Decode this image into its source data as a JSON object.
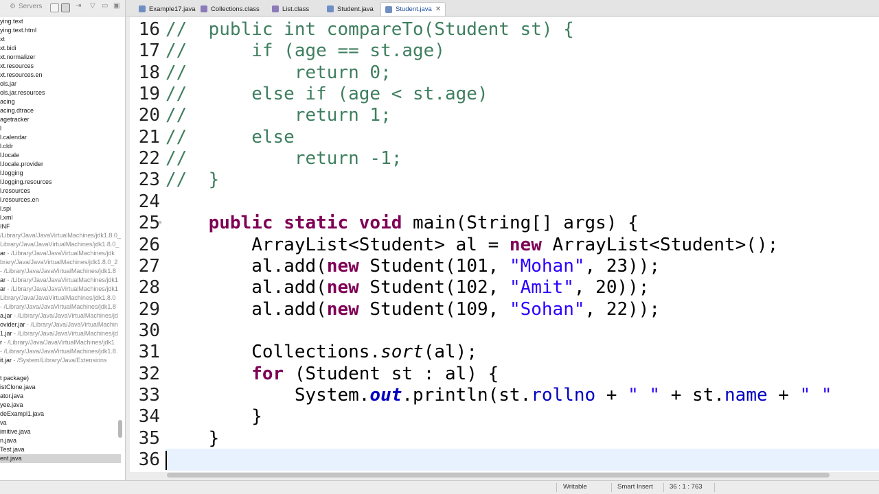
{
  "left_panel": {
    "tab_label": "Servers",
    "tree_items": [
      {
        "name": "ying.text",
        "sub": ""
      },
      {
        "name": "ying.text.html",
        "sub": ""
      },
      {
        "name": "xt",
        "sub": ""
      },
      {
        "name": "xt.bidi",
        "sub": ""
      },
      {
        "name": "xt.normalizer",
        "sub": ""
      },
      {
        "name": "xt.resources",
        "sub": ""
      },
      {
        "name": "xt.resources.en",
        "sub": ""
      },
      {
        "name": "ols.jar",
        "sub": ""
      },
      {
        "name": "ols.jar.resources",
        "sub": ""
      },
      {
        "name": "acing",
        "sub": ""
      },
      {
        "name": "acing.dtrace",
        "sub": ""
      },
      {
        "name": "agetracker",
        "sub": ""
      },
      {
        "name": "l",
        "sub": ""
      },
      {
        "name": "l.calendar",
        "sub": ""
      },
      {
        "name": "l.cldr",
        "sub": ""
      },
      {
        "name": "l.locale",
        "sub": ""
      },
      {
        "name": "l.locale.provider",
        "sub": ""
      },
      {
        "name": "l.logging",
        "sub": ""
      },
      {
        "name": "l.logging.resources",
        "sub": ""
      },
      {
        "name": "l.resources",
        "sub": ""
      },
      {
        "name": "l.resources.en",
        "sub": ""
      },
      {
        "name": "l.spi",
        "sub": ""
      },
      {
        "name": "l.xml",
        "sub": ""
      },
      {
        "name": "INF",
        "sub": ""
      },
      {
        "name": "",
        "sub": "/Library/Java/JavaVirtualMachines/jdk1.8.0_"
      },
      {
        "name": "",
        "sub": "Library/Java/JavaVirtualMachines/jdk1.8.0_"
      },
      {
        "name": "ar",
        "sub": " - /Library/Java/JavaVirtualMachines/jdk"
      },
      {
        "name": "",
        "sub": "brary/Java/JavaVirtualMachines/jdk1.8.0_2"
      },
      {
        "name": "",
        "sub": " - /Library/Java/JavaVirtualMachines/jdk1.8"
      },
      {
        "name": "ar",
        "sub": " - /Library/Java/JavaVirtualMachines/jdk1"
      },
      {
        "name": "ar",
        "sub": " - /Library/Java/JavaVirtualMachines/jdk1"
      },
      {
        "name": "",
        "sub": "Library/Java/JavaVirtualMachines/jdk1.8.0"
      },
      {
        "name": "",
        "sub": " - /Library/Java/JavaVirtualMachines/jdk1.8"
      },
      {
        "name": "a.jar",
        "sub": " - /Library/Java/JavaVirtualMachines/jd"
      },
      {
        "name": "ovider.jar",
        "sub": " - /Library/Java/JavaVirtualMachin"
      },
      {
        "name": "1.jar",
        "sub": " - /Library/Java/JavaVirtualMachines/jd"
      },
      {
        "name": "r",
        "sub": " - /Library/Java/JavaVirtualMachines/jdk1"
      },
      {
        "name": "",
        "sub": " - /Library/Java/JavaVirtualMachines/jdk1.8."
      },
      {
        "name": "it.jar",
        "sub": " - /System/Library/Java/Extensions"
      }
    ],
    "project_items": [
      {
        "name": "t package)",
        "selected": false
      },
      {
        "name": "istClone.java",
        "selected": false
      },
      {
        "name": "ator.java",
        "selected": false
      },
      {
        "name": "yee.java",
        "selected": false
      },
      {
        "name": "deExampl1.java",
        "selected": false
      },
      {
        "name": "va",
        "selected": false
      },
      {
        "name": "imitive.java",
        "selected": false
      },
      {
        "name": "n.java",
        "selected": false
      },
      {
        "name": "Test.java",
        "selected": false
      },
      {
        "name": "ent.java",
        "selected": true
      }
    ]
  },
  "editor_tabs": [
    {
      "label": "Example17.java",
      "active": false,
      "icon_color": "#6f8fc4"
    },
    {
      "label": "Collections.class",
      "active": false,
      "icon_color": "#8a7bb8"
    },
    {
      "label": "List.class",
      "active": false,
      "icon_color": "#8a7bb8"
    },
    {
      "label": "Student.java",
      "active": false,
      "icon_color": "#6f8fc4"
    },
    {
      "label": "Student.java",
      "active": true,
      "icon_color": "#6f8fc4"
    }
  ],
  "code": {
    "lines": [
      {
        "n": "16",
        "t": "//  public int compareTo(Student st) {"
      },
      {
        "n": "17",
        "t": "//      if (age == st.age)"
      },
      {
        "n": "18",
        "t": "//          return 0;"
      },
      {
        "n": "19",
        "t": "//      else if (age < st.age)"
      },
      {
        "n": "20",
        "t": "//          return 1;"
      },
      {
        "n": "21",
        "t": "//      else"
      },
      {
        "n": "22",
        "t": "//          return -1;"
      },
      {
        "n": "23",
        "t": "//  }"
      },
      {
        "n": "24",
        "t": ""
      },
      {
        "n": "25",
        "t": "    public static void main(String[] args) {"
      },
      {
        "n": "26",
        "t": "        ArrayList<Student> al = new ArrayList<Student>();"
      },
      {
        "n": "27",
        "t": "        al.add(new Student(101, \"Mohan\", 23));"
      },
      {
        "n": "28",
        "t": "        al.add(new Student(102, \"Amit\", 20));"
      },
      {
        "n": "29",
        "t": "        al.add(new Student(109, \"Sohan\", 22));"
      },
      {
        "n": "30",
        "t": ""
      },
      {
        "n": "31",
        "t": "        Collections.sort(al);"
      },
      {
        "n": "32",
        "t": "        for (Student st : al) {"
      },
      {
        "n": "33",
        "t": "            System.out.println(st.rollno + \" \" + st.name + \" \""
      },
      {
        "n": "34",
        "t": "        }"
      },
      {
        "n": "35",
        "t": "    }"
      },
      {
        "n": "36",
        "t": ""
      }
    ]
  },
  "status": {
    "writable": "Writable",
    "insert_mode": "Smart Insert",
    "position": "36 : 1 : 763"
  },
  "colors": {
    "comment": "#3f7f5f",
    "keyword": "#7f0055",
    "string": "#2a00ff",
    "field": "#0000c0",
    "current_line": "#e8f2fe"
  }
}
